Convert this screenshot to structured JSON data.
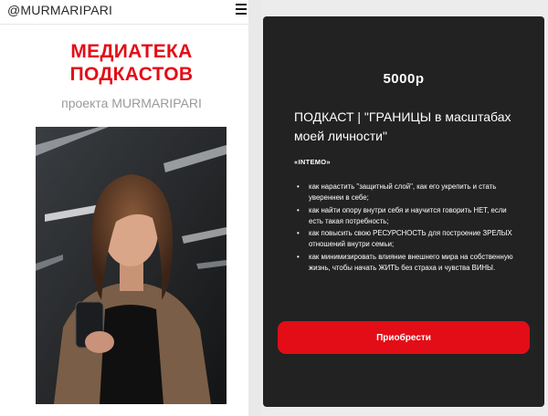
{
  "header": {
    "brand": "@MURMARIPARI",
    "menu_icon": "hamburger-menu-icon"
  },
  "hero": {
    "title_line1": "МЕДИАТЕКА",
    "title_line2": "ПОДКАСТОВ",
    "subtitle": "проекта MURMARIPARI"
  },
  "product": {
    "price": "5000р",
    "title": "ПОДКАСТ | \"ГРАНИЦЫ в масштабах моей личности\"",
    "tag": "«INTEMO»",
    "bullets": [
      "как нарастить \"защитный слой\", как его укрепить и стать увереннеи в себе;",
      "как найти опору внутри себя и научится говорить НЕТ, если есть такая потребность;",
      "как повысить свою РЕСУРСНОСТЬ для построение ЗРЕЛЫХ отношений внутри семьи;",
      "как минимизировать влияние внешнего мира на собственную жизнь, чтобы начать ЖИТЬ без страха и чувства ВИНЫ."
    ],
    "buy_label": "Приобрести"
  },
  "colors": {
    "accent_red": "#e30d17",
    "card_bg": "#222222",
    "subtitle_gray": "#9a9a9a"
  }
}
